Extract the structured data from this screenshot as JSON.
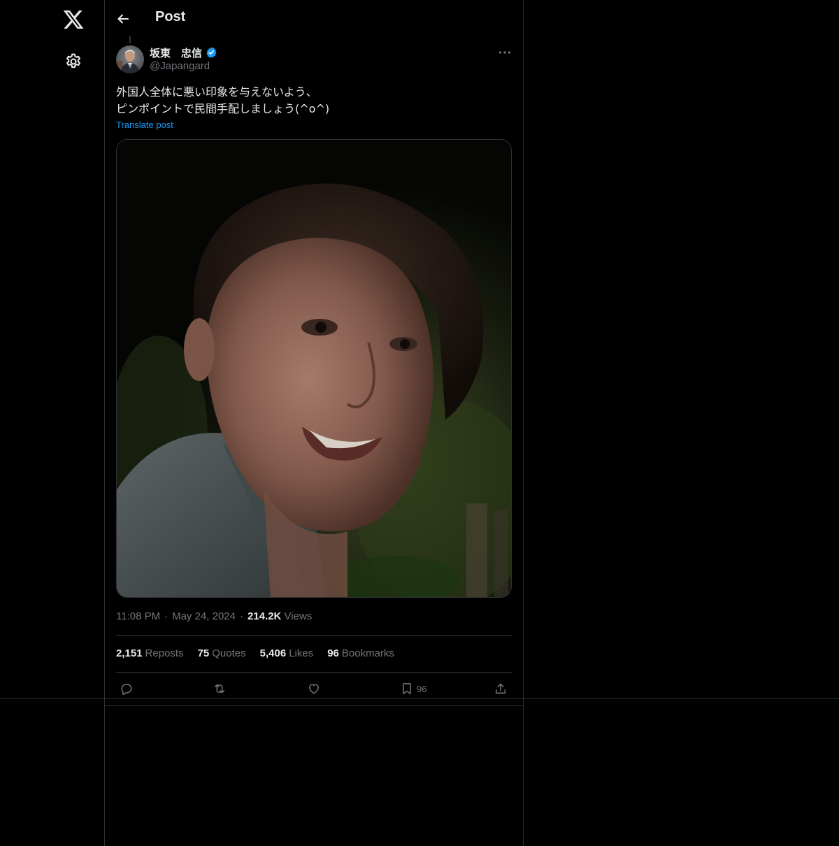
{
  "header": {
    "title": "Post"
  },
  "post": {
    "author": {
      "display_name": "坂東　忠信",
      "handle": "@Japangard",
      "verified": true
    },
    "text_lines": [
      "外国人全体に悪い印象を与えないよう、",
      "ピンポイントで民間手配しましょう(^o^)"
    ],
    "translate_label": "Translate post",
    "meta": {
      "time": "11:08 PM",
      "date": "May 24, 2024",
      "views_count": "214.2K",
      "views_label": "Views"
    },
    "stats": {
      "reposts_count": "2,151",
      "reposts_label": "Reposts",
      "quotes_count": "75",
      "quotes_label": "Quotes",
      "likes_count": "5,406",
      "likes_label": "Likes",
      "bookmarks_count": "96",
      "bookmarks_label": "Bookmarks"
    },
    "actions": {
      "bookmark_count": "96"
    }
  },
  "icons": {
    "logo": "x-logo-icon",
    "settings": "gear-icon",
    "back": "arrow-left-icon",
    "verified": "verified-badge-icon",
    "more": "more-horizontal-icon",
    "reply": "reply-icon",
    "repost": "repost-icon",
    "like": "heart-icon",
    "bookmark": "bookmark-icon",
    "share": "share-icon"
  },
  "colors": {
    "background": "#000000",
    "border": "#2f3336",
    "text_primary": "#e7e9ea",
    "text_secondary": "#71767b",
    "accent": "#1d9bf0"
  }
}
